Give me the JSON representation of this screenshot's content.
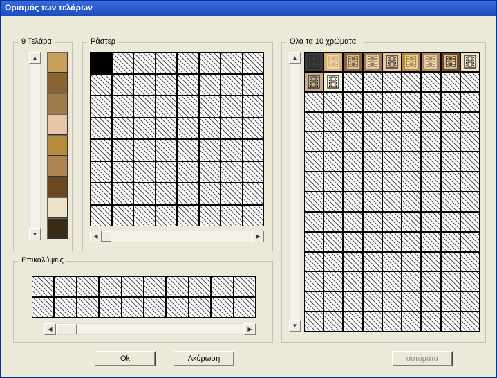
{
  "window": {
    "title": "Ορισμός των τελάρων"
  },
  "frames": {
    "title": "9 Τελάρα",
    "colors": [
      "#C9A05A",
      "#8A6432",
      "#9C7B49",
      "#E7C6A6",
      "#B68C3C",
      "#B18350",
      "#6B4820",
      "#EEE3C8",
      "#3A2A18",
      "#C7A98E"
    ]
  },
  "raster": {
    "title": "Ράστερ",
    "cols": 8,
    "rows": 8,
    "selected_row": 0,
    "selected_col": 0
  },
  "overlap": {
    "title": "Επικαλύψεις",
    "cols": 10,
    "rows": 2
  },
  "colors": {
    "title": "Ολα τα 10 χρώματα",
    "cols": 9,
    "rows": 14,
    "items": [
      {
        "bg": "#3A3A3A",
        "icon": "dark"
      },
      {
        "bg": "#D8B070",
        "icon": "light"
      },
      {
        "bg": "#8A6432",
        "icon": "light"
      },
      {
        "bg": "#9C7B49",
        "icon": "light"
      },
      {
        "bg": "#E7C6A6",
        "icon": "dark"
      },
      {
        "bg": "#B68C3C",
        "icon": "light"
      },
      {
        "bg": "#B18350",
        "icon": "light"
      },
      {
        "bg": "#6B4820",
        "icon": "light"
      },
      {
        "bg": "#EEE3C8",
        "icon": "dark"
      },
      {
        "bg": "#C7A98E",
        "icon": "dark"
      },
      {
        "bg": "#F6F1DF",
        "icon": "dark"
      }
    ]
  },
  "buttons": {
    "ok": "Ok",
    "cancel": "Ακύρωση",
    "auto": "αυτόματα"
  }
}
